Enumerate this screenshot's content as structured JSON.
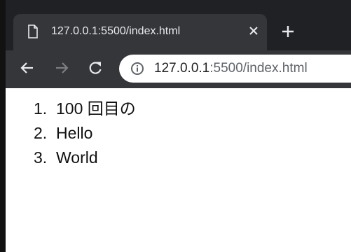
{
  "tab": {
    "title": "127.0.0.1:5500/index.html",
    "icon": "document-icon"
  },
  "toolbar": {
    "url_host": "127.0.0.1",
    "url_rest": ":5500/index.html"
  },
  "page": {
    "items": [
      {
        "number": "1.",
        "text": "100 回目の"
      },
      {
        "number": "2.",
        "text": "Hello"
      },
      {
        "number": "3.",
        "text": "World"
      }
    ]
  }
}
